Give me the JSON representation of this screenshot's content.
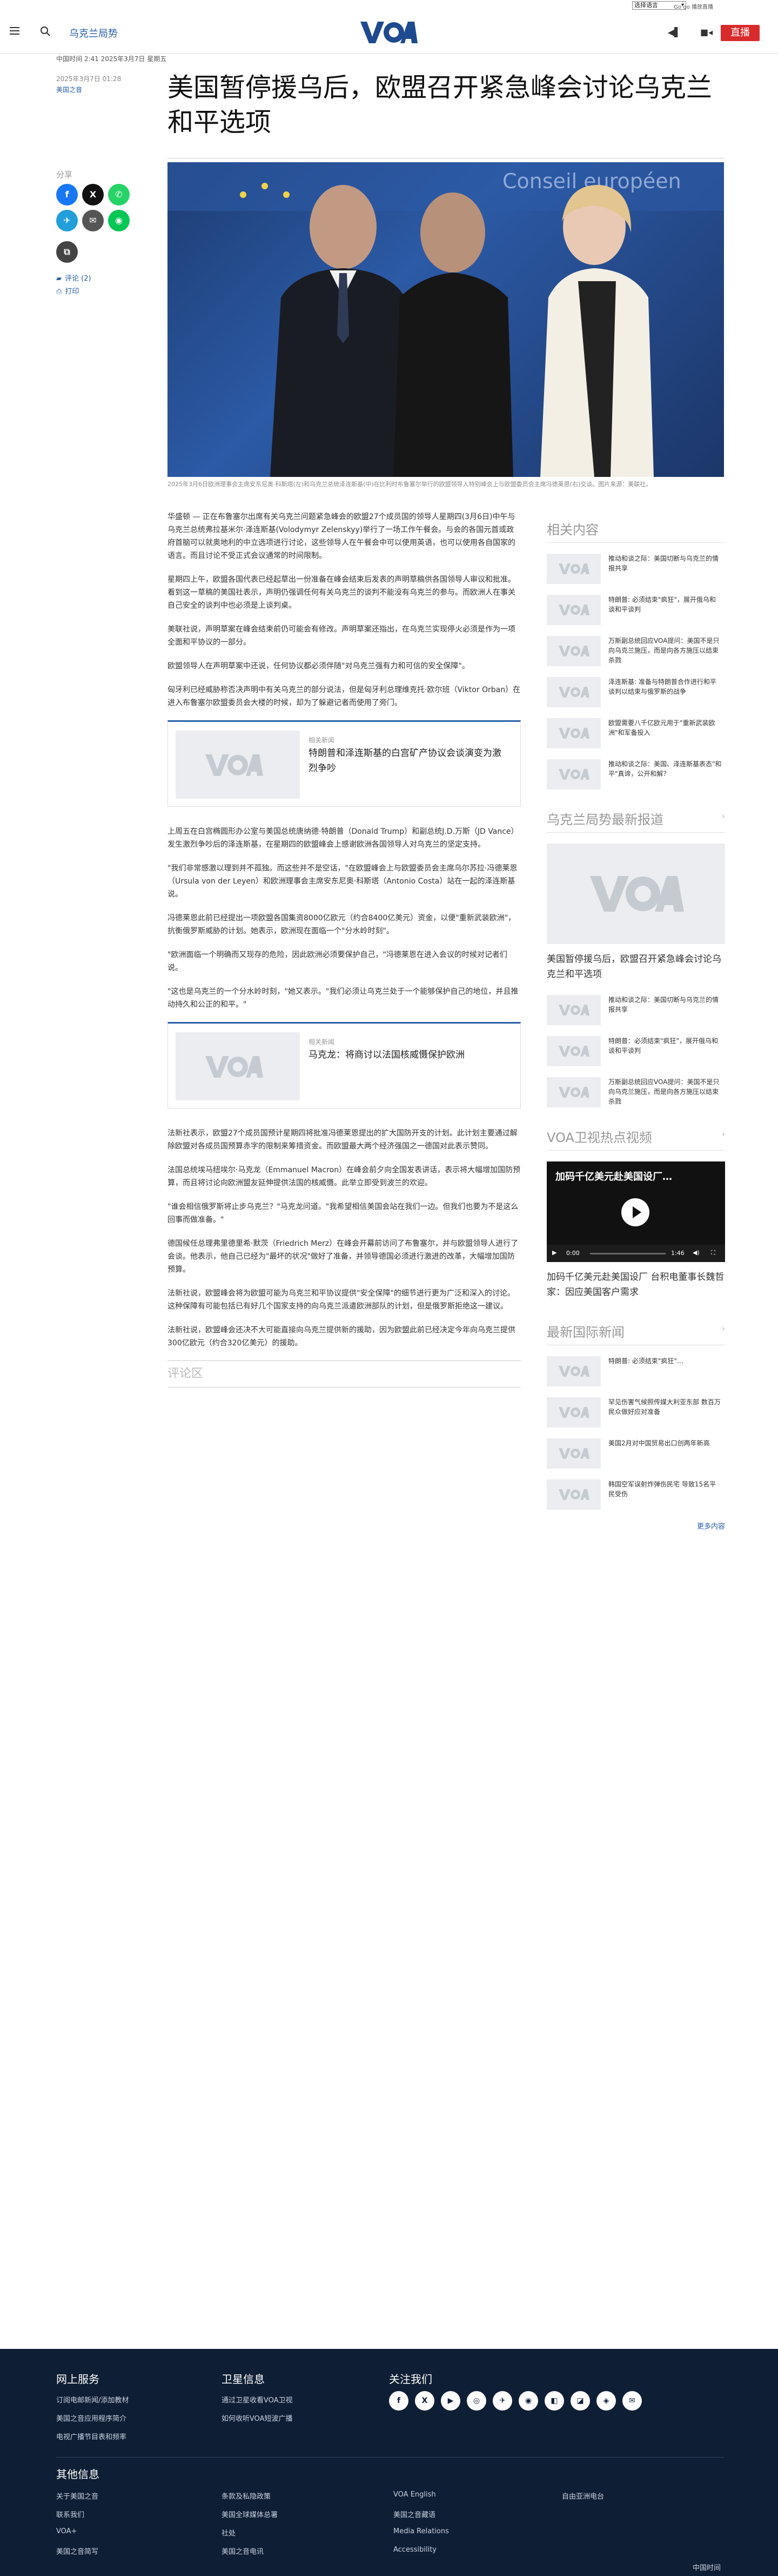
{
  "lang_strip": {
    "selector_value": "选择语言",
    "links": "Go go  播放直播"
  },
  "header": {
    "section": "乌克兰局势",
    "live_label": "直播",
    "logo_text": "VOA"
  },
  "article": {
    "top_line": "中国时间 2:41 2025年3月7日 星期五",
    "date": "2025年3月7日 01:28",
    "author": "美国之音",
    "title": "美国暂停援乌后，欧盟召开紧急峰会讨论乌克兰和平选项",
    "share_label": "分享",
    "comments_link": "评论 (2)",
    "print_link": "打印",
    "caption": "2025年3月6日欧洲理事会主席安东尼奥·科斯塔(左)和乌克兰总统泽连斯基(中)在比利时布鲁塞尔举行的欧盟领导人特别峰会上与欧盟委员会主席冯德莱恩(右)交谈。图片来源：美联社。",
    "paragraphs_a": [
      "华盛顿 — 正在布鲁塞尔出席有关乌克兰问题紧急峰会的欧盟27个成员国的领导人星期四(3月6日)中午与乌克兰总统弗拉基米尔·泽连斯基(Volodymyr Zelenskyy)举行了一场工作午餐会。与会的各国元首或政府首脑可以就奥地利的中立选项进行讨论，这些领导人在午餐会中可以使用英语，也可以使用各自国家的语言。而且讨论不受正式会议通常的时间限制。",
      "星期四上午，欧盟各国代表已经起草出一份准备在峰会结束后发表的声明草稿供各国领导人审议和批准。看到这一草稿的美国社表示，声明仍强调任何有关乌克兰的谈判不能没有乌克兰的参与。而欧洲人在事关自己安全的谈判中也必须是上谈判桌。",
      "美联社说，声明草案在峰会结束前仍可能会有修改。声明草案还指出，在乌克兰实现停火必须是作为一项全面和平协议的一部分。",
      "欧盟领导人在声明草案中还说，任何协议都必须伴随\"对乌克兰强有力和可信的安全保障\"。",
      "匈牙利已经威胁称否决声明中有关乌克兰的部分说法，但是匈牙利总理维克托·欧尔班（Viktor Orban）在进入布鲁塞尔欧盟委员会大楼的时候，却为了躲避记者而使用了旁门。"
    ],
    "related1": {
      "label": "相关新闻",
      "title": "特朗普和泽连斯基的白宫矿产协议会谈演变为激烈争吵"
    },
    "paragraphs_b": [
      "上周五在白宫椭圆形办公室与美国总统唐纳德·特朗普（Donald Trump）和副总统J.D.万斯（JD Vance）发生激烈争吵后的泽连斯基，在星期四的欧盟峰会上感谢欧洲各国领导人对乌克兰的坚定支持。",
      "\"我们非常感激以理到并不孤独。而这些并不是空话，\"在欧盟峰会上与欧盟委员会主席乌尔苏拉·冯德莱恩（Ursula von der Leyen）和欧洲理事会主席安东尼奥·科斯塔（Antonio Costa）站在一起的泽连斯基说。",
      "冯德莱恩此前已经提出一项欧盟各国集资8000亿欧元（约合8400亿美元）资金，以便\"重新武装欧洲\"，抗衡俄罗斯威胁的计划。她表示，欧洲现在面临一个\"分水岭时刻\"。",
      "\"欧洲面临一个明确而又现存的危险，因此欧洲必须要保护自己，\"冯德莱恩在进入会议的时候对记者们说。",
      "\"这也是乌克兰的一个分水岭时刻，\"她又表示。\"我们必须让乌克兰处于一个能够保护自己的地位，并且推动持久和公正的和平。\""
    ],
    "related2": {
      "label": "相关新闻",
      "title": "马克龙：将商讨以法国核威慑保护欧洲"
    },
    "paragraphs_c": [
      "法新社表示，欧盟27个成员国预计星期四将批准冯德莱恩提出的扩大国防开支的计划。此计划主要通过解除欧盟对各成员国预算赤字的限制来筹措资金。而欧盟最大两个经济强国之一德国对此表示赞同。",
      "法国总统埃马纽埃尔·马克龙（Emmanuel Macron）在峰会前夕向全国发表讲话，表示将大幅增加国防预算，而且将讨论向欧洲盟友延伸提供法国的核威慑。此举立即受到波兰的欢迎。",
      "\"谁会相信俄罗斯将止步乌克兰？\"马克龙问道。\"我希望相信美国会站在我们一边。但我们也要为不是这么回事而做准备。\"",
      "德国候任总理弗里德里希·默茨（Friedrich Merz）在峰会开幕前访问了布鲁塞尔，并与欧盟领导人进行了会谈。他表示，他自己已经为\"最坏的状况\"做好了准备，并领导德国必须进行激进的改革，大幅增加国防预算。",
      "法新社说，欧盟峰会将为欧盟可能为乌克兰和平协议提供\"安全保障\"的细节进行更为广泛和深入的讨论。这种保障有可能包括已有好几个国家支持的向乌克兰派遣欧洲部队的计划，但是俄罗斯拒绝这一建议。",
      "法新社说，欧盟峰会还决不大可能直接向乌克兰提供新的援助，因为欧盟此前已经决定今年向乌克兰提供300亿欧元（约合320亿美元）的援助。"
    ],
    "comments_section": "评论区"
  },
  "sidebar": {
    "related_head": "相关内容",
    "related_items": [
      "推动和谈之际：美国切断与乌克兰的情报共享",
      "特朗普: 必须结束\"疯狂\"，展开俄乌和谈和平谈判",
      "万斯副总统回应VOA提问：美国不是只向乌克兰施压，而是向各方施压以结束杀戮",
      "泽连斯基: 准备与特朗普合作进行和平谈判以结束与俄罗斯的战争",
      "欧盟需要八千亿欧元用于\"重新武装欧洲\"和军备投入",
      "推动和谈之际：美国、泽连斯基表态\"和平\"真谛，公开和解？"
    ],
    "latest_head": "乌克兰局势最新报道",
    "latest_big": "美国暂停援乌后，欧盟召开紧急峰会讨论乌克兰和平选项",
    "latest_items": [
      "推动和谈之际：美国切断与乌克兰的情报共享",
      "特朗普：必须结束\"疯狂\"，展开俄乌和谈和平谈判",
      "万斯副总统回应VOA提问：美国不是只向乌克兰施压，而是向各方施压以结束杀戮"
    ],
    "video_head": "VOA卫视热点视频",
    "video_overlay": "加码千亿美元赴美国设厂…",
    "video_time": "0:00",
    "video_duration": "1:46",
    "video_title": "加码千亿美元赴美国设厂 台积电董事长魏哲家：因应美国客户需求",
    "intl_head": "最新国际新闻",
    "intl_items": [
      "特朗普: 必须结束\"疯狂\"…",
      "罕见伤害气候照传媒大利亚东部 数百万民众做好应对准备",
      "美国2月对中国贸易出口创两年新高",
      "韩国空军误射炸弹伤民宅 导致15名平民受伤"
    ],
    "more": "更多内容"
  },
  "footer": {
    "online_head": "网上服务",
    "online_links": [
      "订阅电邮新闻/添加教材",
      "美国之音应用程序简介",
      "电视广播节目表和频率"
    ],
    "satellite_head": "卫星信息",
    "satellite_links": [
      "通过卫星收看VOA卫视",
      "如何收听VOA短波广播"
    ],
    "follow_head": "关注我们",
    "social": [
      "f",
      "X",
      "▶",
      "◎",
      "✈",
      "◉",
      "◧",
      "◪",
      "◈",
      "✉"
    ],
    "other_head": "其他信息",
    "other_col1": [
      "关于美国之音",
      "联系我们",
      "VOA+",
      "美国之音简写"
    ],
    "other_col2": [
      "条款及私隐政策",
      "美国全球媒体总署",
      "社处",
      "美国之音电讯"
    ],
    "other_col3": [
      "VOA English",
      "美国之音藏语",
      "Media Relations",
      "Accessibility"
    ],
    "other_col4": [
      "自由亚洲电台"
    ],
    "bottom_label": "中国时间"
  },
  "colors": {
    "accent": "#2a5fa8",
    "live": "#d92b2b",
    "footer_bg": "#0e1e34"
  }
}
